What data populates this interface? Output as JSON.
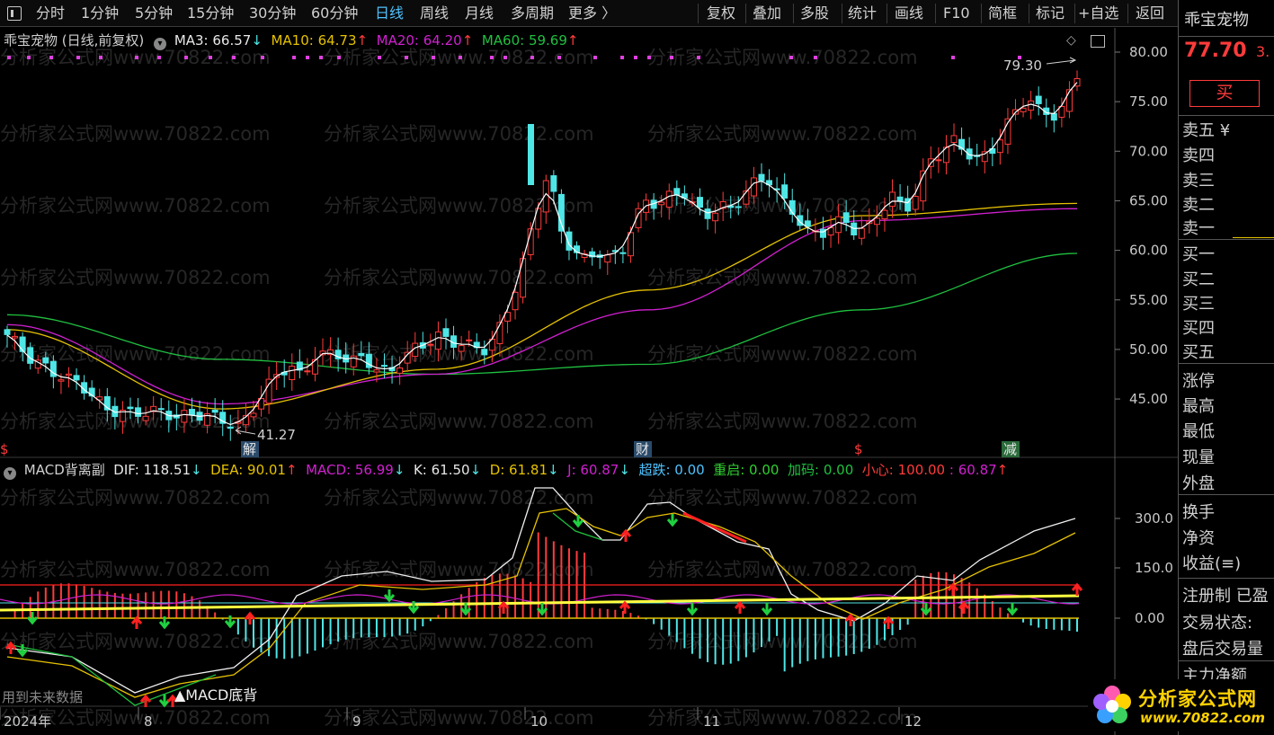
{
  "toolbar": {
    "left_items": [
      "分时",
      "1分钟",
      "5分钟",
      "15分钟",
      "30分钟",
      "60分钟",
      "日线",
      "周线",
      "月线",
      "多周期",
      "更多 〉"
    ],
    "active_item": "日线",
    "right_items": [
      "复权",
      "叠加",
      "多股",
      "统计",
      "画线",
      "F10",
      "简框",
      "标记",
      "+自选",
      "返回"
    ]
  },
  "main_chart": {
    "title": "乖宝宠物 (日线,前复权)",
    "ma3": "MA3: 66.57",
    "ma10": "MA10: 64.73",
    "ma20": "MA20: 64.20",
    "ma60": "MA60: 59.69",
    "arrow_down": "↓",
    "arrow_up": "↑",
    "high_label": "79.30",
    "low_label": "41.27",
    "y_ticks": [
      "80.00",
      "75.00",
      "70.00",
      "65.00",
      "60.00",
      "55.00",
      "50.00",
      "45.00"
    ],
    "markers": {
      "jie": "解",
      "cai": "财",
      "jian": "减",
      "dollar": "$"
    },
    "watermark": "分析家公式网www.70822.com"
  },
  "sub_chart": {
    "title": "MACD背离副",
    "dif": "DIF: 118.51",
    "dea": "DEA: 90.01",
    "macd": "MACD: 56.99",
    "k": "K: 61.50",
    "d": "D: 61.81",
    "j": "J: 60.87",
    "chaodie": "超跌: 0.00",
    "chongqi": "重启: 0.00",
    "jiama": "加码: 0.00",
    "xiaoxin": "小心: 100.00",
    "extra": ": 60.87",
    "y_ticks": [
      "300.0",
      "150.0",
      "0.00"
    ],
    "note_left": "用到未来数据",
    "macd_bottom": "▲MACD底背"
  },
  "x_axis": {
    "labels": [
      "2024年",
      "8",
      "9",
      "10",
      "11",
      "12"
    ]
  },
  "right_panel": {
    "stock_name": "乖宝宠物",
    "price": "77.70",
    "price_extra": "3.",
    "buy_label": "买",
    "sell_rows": [
      "卖五 ¥",
      "卖四",
      "卖三",
      "卖二",
      "卖一"
    ],
    "buy_rows": [
      "买一",
      "买二",
      "买三",
      "买四",
      "买五"
    ],
    "stat_rows": [
      "涨停",
      "最高",
      "最低",
      "现量",
      "外盘"
    ],
    "stat_rows2": [
      "换手",
      "净资",
      "收益(≡)"
    ],
    "info_rows": [
      "注册制 已盈",
      "交易状态:",
      "盘后交易量",
      "主力净额"
    ]
  },
  "logo": {
    "title": "分析家公式网",
    "url": "www.70822.com"
  },
  "colors": {
    "up": "#ff3b3b",
    "down": "#4fe6e6",
    "ma3": "#ffffff",
    "ma10": "#e6c200",
    "ma20": "#d020d0",
    "ma60": "#20c040",
    "accent": "#4fc3ff"
  },
  "chart_data": {
    "type": "line",
    "title": "乖宝宠物 (日线,前复权)",
    "x": [
      "2024-07",
      "2024-08",
      "2024-09",
      "2024-10",
      "2024-11",
      "2024-12"
    ],
    "ylim": [
      40,
      82
    ],
    "series": [
      {
        "name": "MA3",
        "values": [
          51.5,
          43.0,
          48.5,
          58.0,
          64.0,
          66.57
        ]
      },
      {
        "name": "MA10",
        "values": [
          52.0,
          44.0,
          48.0,
          56.0,
          63.5,
          64.73
        ]
      },
      {
        "name": "MA20",
        "values": [
          52.5,
          44.5,
          47.5,
          54.0,
          63.0,
          64.2
        ]
      },
      {
        "name": "MA60",
        "values": [
          53.5,
          49.0,
          47.5,
          48.5,
          54.0,
          59.69
        ]
      }
    ],
    "annotations": [
      {
        "label": "79.30"
      },
      {
        "label": "41.27"
      }
    ],
    "grid": false,
    "legend": "top-left"
  }
}
